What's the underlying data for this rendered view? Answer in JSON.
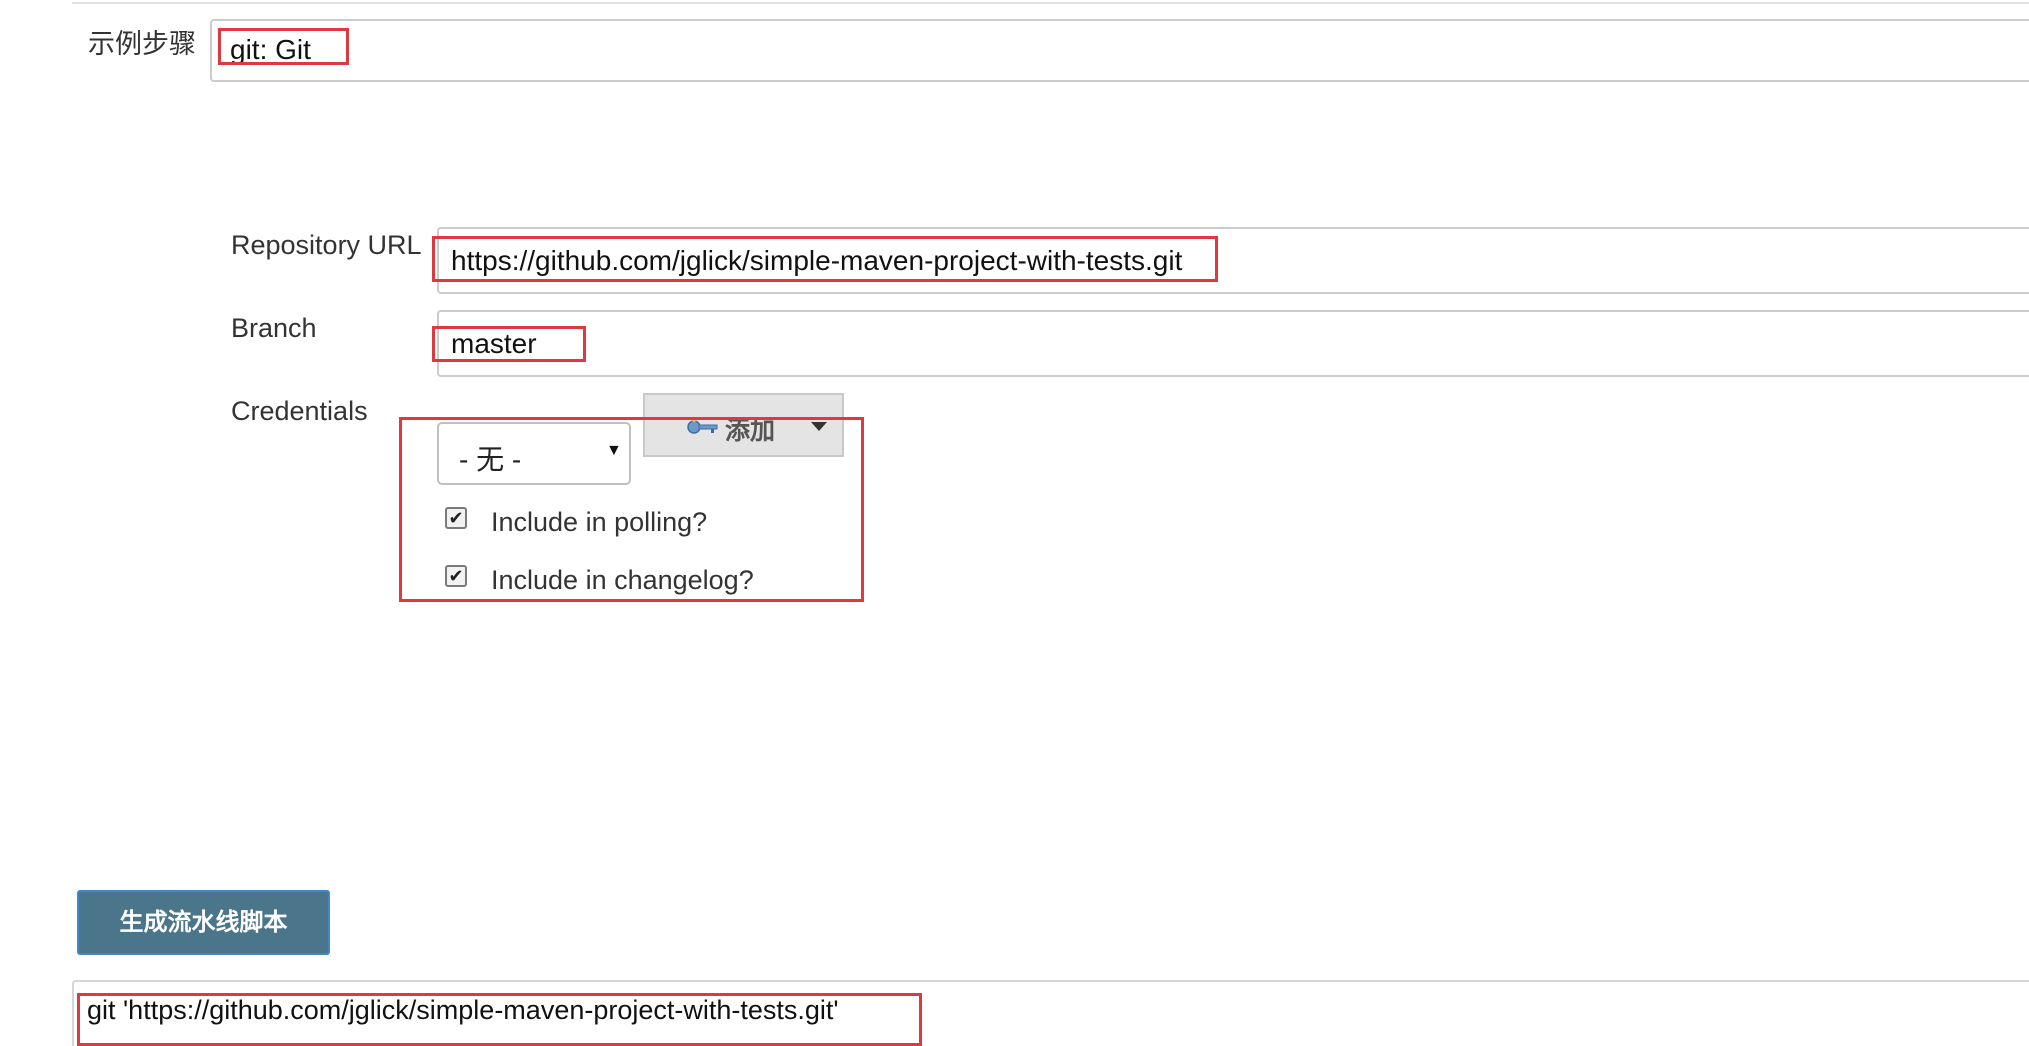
{
  "sample_step": {
    "label": "示例步骤",
    "value": "git: Git"
  },
  "repository_url": {
    "label": "Repository URL",
    "value": "https://github.com/jglick/simple-maven-project-with-tests.git"
  },
  "branch": {
    "label": "Branch",
    "value": "master"
  },
  "credentials": {
    "label": "Credentials",
    "selected": "- 无 -",
    "add_button_label": "添加",
    "add_button_icon": "key-icon"
  },
  "options": [
    {
      "label": "Include in polling?",
      "checked": true
    },
    {
      "label": "Include in changelog?",
      "checked": true
    }
  ],
  "generate_button_label": "生成流水线脚本",
  "generated_script": "git 'https://github.com/jglick/simple-maven-project-with-tests.git'",
  "colors": {
    "highlight": "#e0383f",
    "button_bg": "#4b758b",
    "button_border": "#3e87cf"
  }
}
